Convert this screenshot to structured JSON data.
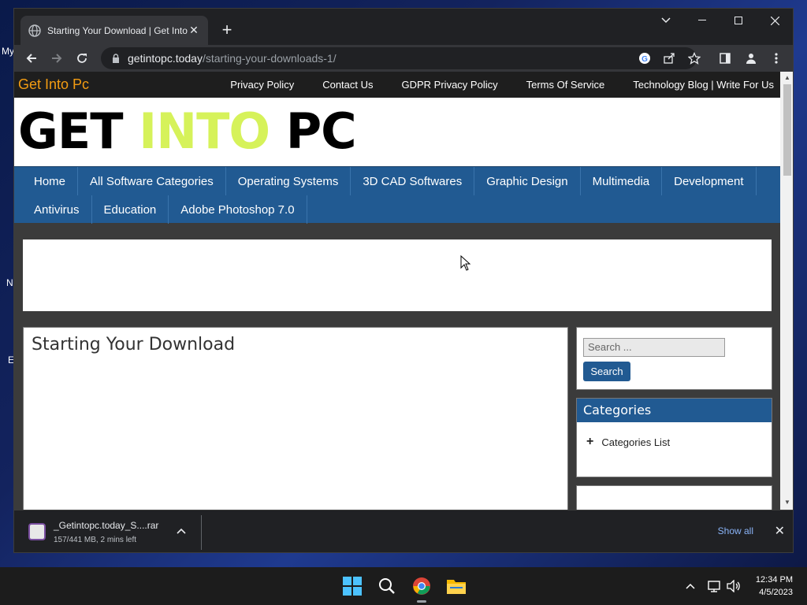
{
  "desktop": {
    "fragments": [
      "My",
      "N",
      "E"
    ]
  },
  "browser": {
    "tab": {
      "title": "Starting Your Download | Get Into Pc"
    },
    "address": {
      "host": "getintopc.today",
      "path": "/starting-your-downloads-1/"
    }
  },
  "site": {
    "brand": "Get Into Pc",
    "top_links": [
      "Privacy Policy",
      "Contact Us",
      "GDPR Privacy Policy",
      "Terms Of Service",
      "Technology Blog | Write For Us"
    ],
    "logo": {
      "get": "GET",
      "into": "INTO",
      "pc": "PC"
    },
    "menu_row1": [
      "Home",
      "All Software Categories",
      "Operating Systems",
      "3D CAD Softwares",
      "Graphic Design",
      "Multimedia",
      "Development"
    ],
    "menu_row2": [
      "Antivirus",
      "Education",
      "Adobe Photoshop 7.0"
    ],
    "content": {
      "heading": "Starting Your Download"
    },
    "search": {
      "placeholder": "Search ...",
      "button": "Search"
    },
    "categories": {
      "title": "Categories",
      "item": "Categories List"
    }
  },
  "downloads": {
    "filename": "_Getintopc.today_S....rar",
    "status": "157/441 MB, 2 mins left",
    "show_all": "Show all"
  },
  "taskbar": {
    "time": "12:34 PM",
    "date": "4/5/2023"
  },
  "colors": {
    "brand": "#f39c12",
    "menu_blue": "#215a92",
    "logo_into": "#d6f25a",
    "link_blue": "#8ab4f8"
  }
}
